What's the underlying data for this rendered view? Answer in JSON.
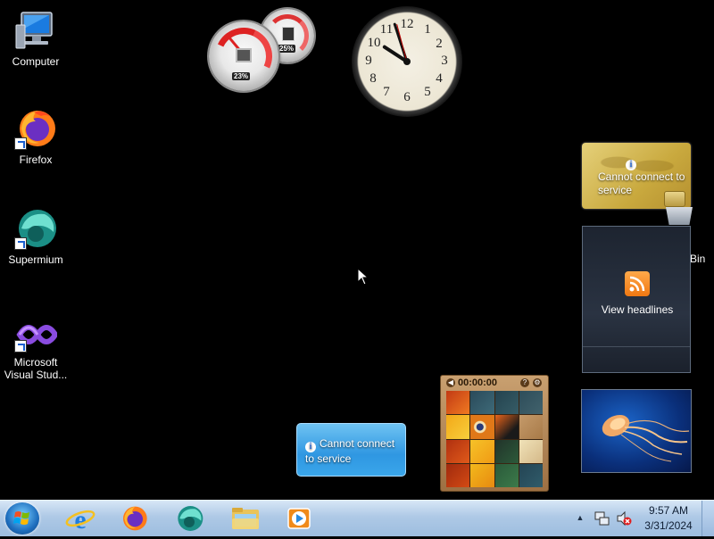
{
  "desktop": {
    "icons": [
      {
        "label": "Computer"
      },
      {
        "label": "Firefox"
      },
      {
        "label": "Supermium"
      },
      {
        "label": "Microsoft Visual Stud..."
      }
    ],
    "recycle_bin_partial_label": "Bin"
  },
  "gadgets": {
    "cpu_meter": {
      "cpu_percent": "23%",
      "memory_percent": "25%"
    },
    "clock": {
      "numbers": [
        "12",
        "1",
        "2",
        "3",
        "4",
        "5",
        "6",
        "7",
        "8",
        "9",
        "10",
        "11"
      ],
      "time": "9:57"
    },
    "currency": {
      "message": "Cannot connect to service"
    },
    "feed": {
      "action": "View headlines"
    },
    "weather": {
      "message": "Cannot connect to service"
    },
    "puzzle": {
      "timer": "00:00:00"
    },
    "slideshow": {
      "image": "jellyfish"
    }
  },
  "taskbar": {
    "clock_time": "9:57 AM",
    "clock_date": "3/31/2024",
    "apps": [
      {
        "name": "Internet Explorer"
      },
      {
        "name": "Firefox"
      },
      {
        "name": "Supermium"
      },
      {
        "name": "Windows Explorer"
      },
      {
        "name": "Windows Media Player"
      }
    ]
  }
}
